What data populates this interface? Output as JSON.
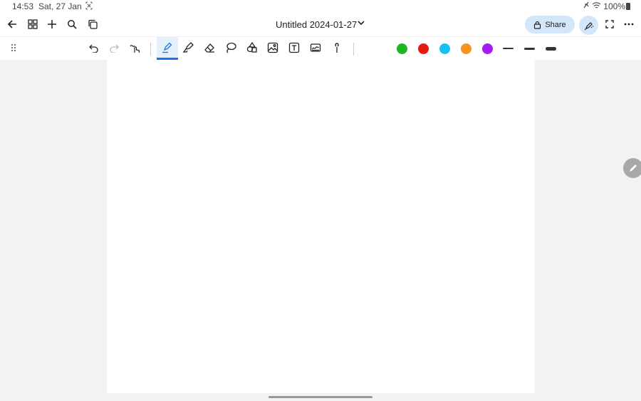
{
  "status_bar": {
    "time": "14:53",
    "date": "Sat, 27 Jan",
    "battery": "100%"
  },
  "header": {
    "title": "Untitled 2024-01-27",
    "share_label": "Share"
  },
  "toolbar": {
    "colors": [
      "#1fb71f",
      "#e8190f",
      "#19c1f0",
      "#f59421",
      "#a51bf2"
    ],
    "strokes": [
      "thin",
      "medium",
      "thick"
    ]
  }
}
